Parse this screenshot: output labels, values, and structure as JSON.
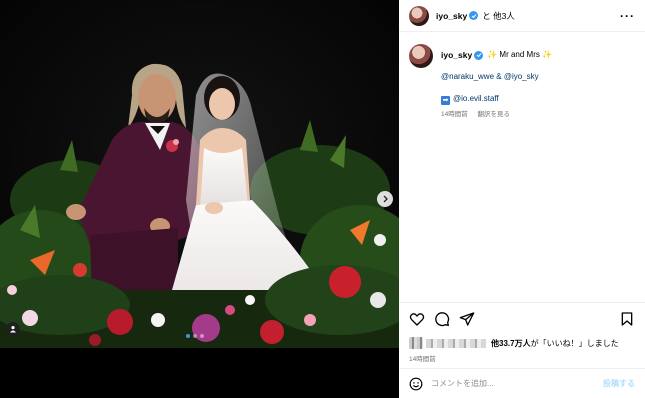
{
  "post": {
    "author": "iyo_sky",
    "with_others": "と 他3人",
    "more_icon": "more-horizontal-icon"
  },
  "caption": {
    "author": "iyo_sky",
    "text": "Mr and Mrs",
    "sparkle": "✨",
    "mentions_line": "@naraku_wwe & @iyo_sky",
    "staff_line": "@io.evil.staff",
    "time_ago": "14時間前",
    "translate": "翻訳を見る"
  },
  "likes": {
    "count_text": "他33.7万人",
    "suffix": "が「いいね！」しました"
  },
  "date": "14時間前",
  "comment": {
    "placeholder": "コメントを追加...",
    "post_label": "投稿する"
  },
  "carousel": {
    "slides": 3,
    "active": 1
  },
  "colors": {
    "accent": "#3797f0",
    "link": "#00376b",
    "suit": "#4a1530",
    "dress": "#f4f1f0"
  }
}
